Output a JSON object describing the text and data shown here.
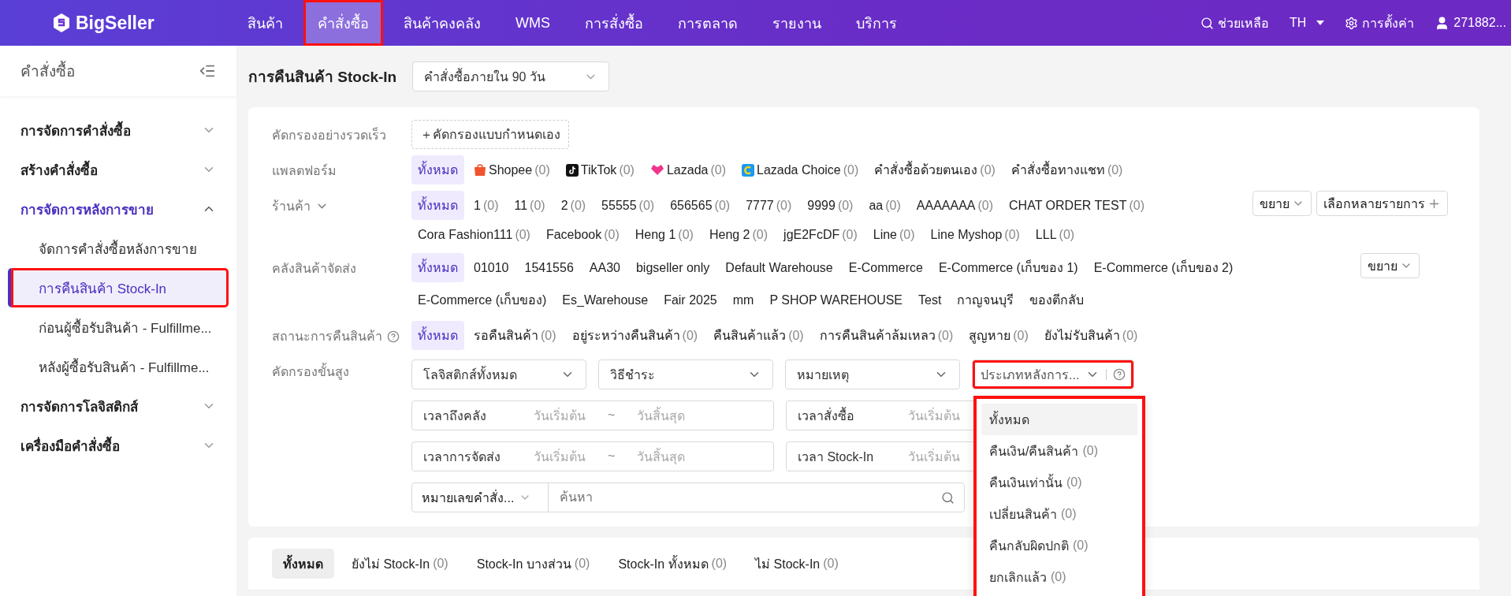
{
  "topbar": {
    "logo": "BigSeller",
    "nav": [
      {
        "label": "สินค้า",
        "selected": false,
        "highlighted": false
      },
      {
        "label": "คำสั่งซื้อ",
        "selected": true,
        "highlighted": true
      },
      {
        "label": "สินค้าคงคลัง",
        "selected": false,
        "highlighted": false
      },
      {
        "label": "WMS",
        "selected": false,
        "highlighted": false
      },
      {
        "label": "การสั่งซื้อ",
        "selected": false,
        "highlighted": false
      },
      {
        "label": "การตลาด",
        "selected": false,
        "highlighted": false
      },
      {
        "label": "รายงาน",
        "selected": false,
        "highlighted": false
      },
      {
        "label": "บริการ",
        "selected": false,
        "highlighted": false
      }
    ],
    "help": "ช่วยเหลือ",
    "language": "TH",
    "settings": "การตั้งค่า",
    "user": "271882..."
  },
  "sidebar": {
    "title": "คำสั่งซื้อ",
    "items": [
      {
        "label": "การจัดการคำสั่งซื้อ",
        "expanded": false
      },
      {
        "label": "สร้างคำสั่งซื้อ",
        "expanded": false
      },
      {
        "label": "การจัดการหลังการขาย",
        "expanded": true,
        "children": [
          {
            "label": "จัดการคำสั่งซื้อหลังการขาย",
            "selected": false,
            "highlighted": false
          },
          {
            "label": "การคืนสินค้า Stock-In",
            "selected": true,
            "highlighted": true
          },
          {
            "label": "ก่อนผู้ซื้อรับสินค้า - Fulfillme...",
            "selected": false,
            "highlighted": false
          },
          {
            "label": "หลังผู้ซื้อรับสินค้า - Fulfillme...",
            "selected": false,
            "highlighted": false
          }
        ]
      },
      {
        "label": "การจัดการโลจิสติกส์",
        "expanded": false
      },
      {
        "label": "เครื่องมือคำสั่งซื้อ",
        "expanded": false
      }
    ]
  },
  "page": {
    "title": "การคืนสินค้า Stock-In",
    "period_select": "คำสั่งซื้อภายใน 90 วัน"
  },
  "filters": {
    "quick": {
      "label": "คัดกรองอย่างรวดเร็ว",
      "button": "＋คัดกรองแบบกำหนดเอง"
    },
    "platform": {
      "label": "แพลตฟอร์ม",
      "options": [
        {
          "kind": "plain",
          "label": "ทั้งหมด",
          "selected": true
        },
        {
          "kind": "shopee",
          "label": "Shopee",
          "count": "(0)",
          "selected": false
        },
        {
          "kind": "tiktok",
          "label": "TikTok",
          "count": "(0)",
          "selected": false
        },
        {
          "kind": "lazada",
          "label": "Lazada",
          "count": "(0)",
          "selected": false
        },
        {
          "kind": "lazada_choice",
          "label": "Lazada Choice",
          "count": "(0)",
          "selected": false
        },
        {
          "kind": "plain",
          "label": "คำสั่งซื้อด้วยตนเอง",
          "count": "(0)",
          "selected": false
        },
        {
          "kind": "plain",
          "label": "คำสั่งซื้อทางแชท",
          "count": "(0)",
          "selected": false
        }
      ]
    },
    "shop": {
      "label": "ร้านค้า",
      "expand_button": "ขยาย",
      "multi_button": "เลือกหลายรายการ",
      "options": [
        {
          "label": "ทั้งหมด",
          "selected": true
        },
        {
          "label": "1",
          "count": "(0)",
          "selected": false
        },
        {
          "label": "11",
          "count": "(0)",
          "selected": false
        },
        {
          "label": "2",
          "count": "(0)",
          "selected": false
        },
        {
          "label": "55555",
          "count": "(0)",
          "selected": false
        },
        {
          "label": "656565",
          "count": "(0)",
          "selected": false
        },
        {
          "label": "7777",
          "count": "(0)",
          "selected": false
        },
        {
          "label": "9999",
          "count": "(0)",
          "selected": false
        },
        {
          "label": "aa",
          "count": "(0)",
          "selected": false
        },
        {
          "label": "AAAAAAA",
          "count": "(0)",
          "selected": false
        },
        {
          "label": "CHAT ORDER TEST",
          "count": "(0)",
          "selected": false
        },
        {
          "label": "Cora Fashion111",
          "count": "(0)",
          "selected": false
        },
        {
          "label": "Facebook",
          "count": "(0)",
          "selected": false
        },
        {
          "label": "Heng 1",
          "count": "(0)",
          "selected": false
        },
        {
          "label": "Heng 2",
          "count": "(0)",
          "selected": false
        },
        {
          "label": "jgE2FcDF",
          "count": "(0)",
          "selected": false
        },
        {
          "label": "Line",
          "count": "(0)",
          "selected": false
        },
        {
          "label": "Line Myshop",
          "count": "(0)",
          "selected": false
        },
        {
          "label": "LLL",
          "count": "(0)",
          "selected": false
        }
      ]
    },
    "warehouse": {
      "label": "คลังสินค้าจัดส่ง",
      "expand_button": "ขยาย",
      "options": [
        {
          "label": "ทั้งหมด",
          "selected": true
        },
        {
          "label": "01010",
          "selected": false
        },
        {
          "label": "1541556",
          "selected": false
        },
        {
          "label": "AA30",
          "selected": false
        },
        {
          "label": "bigseller only",
          "selected": false
        },
        {
          "label": "Default Warehouse",
          "selected": false
        },
        {
          "label": "E-Commerce",
          "selected": false
        },
        {
          "label": "E-Commerce (เก็บของ 1)",
          "selected": false
        },
        {
          "label": "E-Commerce (เก็บของ 2)",
          "selected": false
        },
        {
          "label": "E-Commerce (เก็บของ)",
          "selected": false
        },
        {
          "label": "Es_Warehouse",
          "selected": false
        },
        {
          "label": "Fair 2025",
          "selected": false
        },
        {
          "label": "mm",
          "selected": false
        },
        {
          "label": "P SHOP WAREHOUSE",
          "selected": false
        },
        {
          "label": "Test",
          "selected": false
        },
        {
          "label": "กาญจนบุรี",
          "selected": false
        },
        {
          "label": "ของตีกลับ",
          "selected": false
        }
      ]
    },
    "status": {
      "label": "สถานะการคืนสินค้า",
      "options": [
        {
          "label": "ทั้งหมด",
          "selected": true
        },
        {
          "label": "รอคืนสินค้า",
          "count": "(0)",
          "selected": false
        },
        {
          "label": "อยู่ระหว่างคืนสินค้า",
          "count": "(0)",
          "selected": false
        },
        {
          "label": "คืนสินค้าแล้ว",
          "count": "(0)",
          "selected": false
        },
        {
          "label": "การคืนสินค้าล้มเหลว",
          "count": "(0)",
          "selected": false
        },
        {
          "label": "สูญหาย",
          "count": "(0)",
          "selected": false
        },
        {
          "label": "ยังไม่รับสินค้า",
          "count": "(0)",
          "selected": false
        }
      ]
    },
    "advanced": {
      "label": "คัดกรองขั้นสูง",
      "selects": [
        {
          "value": "โลจิสติกส์ทั้งหมด"
        },
        {
          "value": "วิธีชำระ"
        },
        {
          "value": "หมายเหตุ"
        }
      ],
      "after_sale_select": {
        "value": "ประเภทหลังการ...",
        "highlighted": true
      },
      "date_ranges": [
        {
          "label": "เวลาถึงคลัง",
          "start": "วันเริ่มต้น",
          "separator": "~",
          "end": "วันสิ้นสุด"
        },
        {
          "label": "เวลาสั่งซื้อ",
          "start": "วันเริ่มต้น"
        },
        {
          "label": "เวลาการจัดส่ง",
          "start": "วันเริ่มต้น",
          "separator": "~",
          "end": "วันสิ้นสุด"
        },
        {
          "label": "เวลา Stock-In",
          "start": "วันเริ่มต้น"
        }
      ],
      "search_type": "หมายเลขคำสั่ง...",
      "search_placeholder": "ค้นหา"
    }
  },
  "dropdown": {
    "highlighted": true,
    "options": [
      {
        "label": "ทั้งหมด",
        "selected": true
      },
      {
        "label": "คืนเงิน/คืนสินค้า",
        "count": "(0)",
        "selected": false
      },
      {
        "label": "คืนเงินเท่านั้น",
        "count": "(0)",
        "selected": false
      },
      {
        "label": "เปลี่ยนสินค้า",
        "count": "(0)",
        "selected": false
      },
      {
        "label": "คืนกลับผิดปกติ",
        "count": "(0)",
        "selected": false
      },
      {
        "label": "ยกเลิกแล้ว",
        "count": "(0)",
        "selected": false
      }
    ]
  },
  "tabs": [
    {
      "label": "ทั้งหมด",
      "selected": true
    },
    {
      "label": "ยังไม่ Stock-In",
      "count": "(0)",
      "selected": false
    },
    {
      "label": "Stock-In บางส่วน",
      "count": "(0)",
      "selected": false
    },
    {
      "label": "Stock-In ทั้งหมด",
      "count": "(0)",
      "selected": false
    },
    {
      "label": "ไม่ Stock-In",
      "count": "(0)",
      "selected": false
    }
  ]
}
